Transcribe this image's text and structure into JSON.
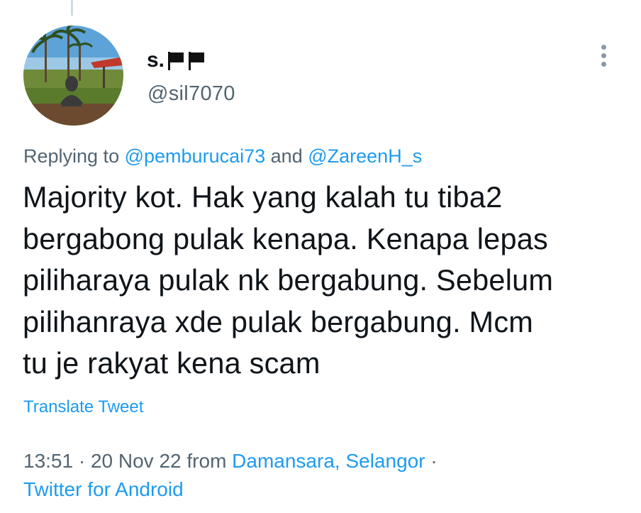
{
  "user": {
    "display_name": "s.",
    "flag_icon": "black-flag-icon",
    "handle": "@sil7070"
  },
  "reply": {
    "prefix": "Replying to",
    "mentions": [
      "@pemburucai73",
      "@ZareenH_s"
    ],
    "joiner": "and"
  },
  "tweet": {
    "lines": [
      "Majority kot. Hak yang kalah tu tiba2",
      "bergabong pulak kenapa. Kenapa lepas",
      "piliharaya pulak nk bergabung. Sebelum",
      "pilihanraya xde pulak bergabung. Mcm",
      "tu je rakyat kena scam"
    ],
    "translate_label": "Translate Tweet"
  },
  "meta": {
    "time": "13:51",
    "separator": "·",
    "date": "20 Nov 22",
    "from_label": "from",
    "location": "Damansara, Selangor",
    "source": "Twitter for Android"
  },
  "colors": {
    "accent": "#1d9bf0",
    "text": "#0f1419",
    "secondary": "#536471"
  }
}
